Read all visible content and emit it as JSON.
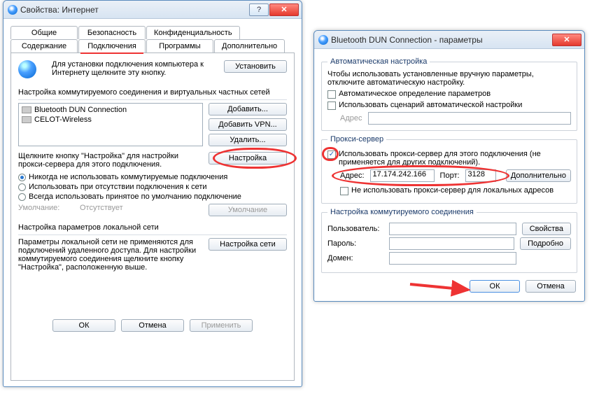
{
  "win1": {
    "title": "Свойства: Интернет",
    "tabs_row1": [
      "Общие",
      "Безопасность",
      "Конфиденциальность"
    ],
    "tabs_row2": [
      "Содержание",
      "Подключения",
      "Программы",
      "Дополнительно"
    ],
    "active_tab": "Подключения",
    "install_text": "Для установки подключения компьютера к Интернету щелкните эту кнопку.",
    "install_btn": "Установить",
    "conn_section": "Настройка коммутируемого соединения и виртуальных частных сетей",
    "conns": [
      "Bluetooth DUN Connection",
      "CELOT-Wireless"
    ],
    "btn_add": "Добавить...",
    "btn_add_vpn": "Добавить VPN...",
    "btn_remove": "Удалить...",
    "settings_hint": "Щелкните кнопку \"Настройка\" для настройки прокси-сервера для этого подключения.",
    "btn_settings": "Настройка",
    "radios": {
      "r1": "Никогда не использовать коммутируемые подключения",
      "r2": "Использовать при отсутствии подключения к сети",
      "r3": "Всегда использовать принятое по умолчанию подключение"
    },
    "default_label": "Умолчание:",
    "default_value": "Отсутствует",
    "btn_default": "Умолчание",
    "lan_section": "Настройка параметров локальной сети",
    "lan_text": "Параметры локальной сети не применяются для подключений удаленного доступа. Для настройки коммутируемого соединения щелкните кнопку \"Настройка\", расположенную выше.",
    "btn_lan": "Настройка сети",
    "btn_ok": "ОК",
    "btn_cancel": "Отмена",
    "btn_apply": "Применить"
  },
  "win2": {
    "title": "Bluetooth DUN Connection - параметры",
    "auto_group": "Автоматическая настройка",
    "auto_text": "Чтобы использовать установленные вручную параметры, отключите автоматическую настройку.",
    "chk_autodetect": "Автоматическое определение параметров",
    "chk_script": "Использовать сценарий автоматической настройки",
    "addr_label": "Адрес",
    "proxy_group": "Прокси-сервер",
    "chk_useproxy": "Использовать прокси-сервер для этого подключения (не применяется для других подключений).",
    "proxy_addr_label": "Адрес:",
    "proxy_addr_value": "17.174.242.166",
    "proxy_port_label": "Порт:",
    "proxy_port_value": "3128",
    "btn_advanced": "Дополнительно",
    "chk_bypass_local": "Не использовать прокси-сервер для локальных адресов",
    "dial_group": "Настройка коммутируемого соединения",
    "lbl_user": "Пользователь:",
    "lbl_pass": "Пароль:",
    "lbl_domain": "Домен:",
    "btn_props": "Свойства",
    "btn_detail": "Подробно",
    "btn_ok": "ОК",
    "btn_cancel": "Отмена"
  }
}
